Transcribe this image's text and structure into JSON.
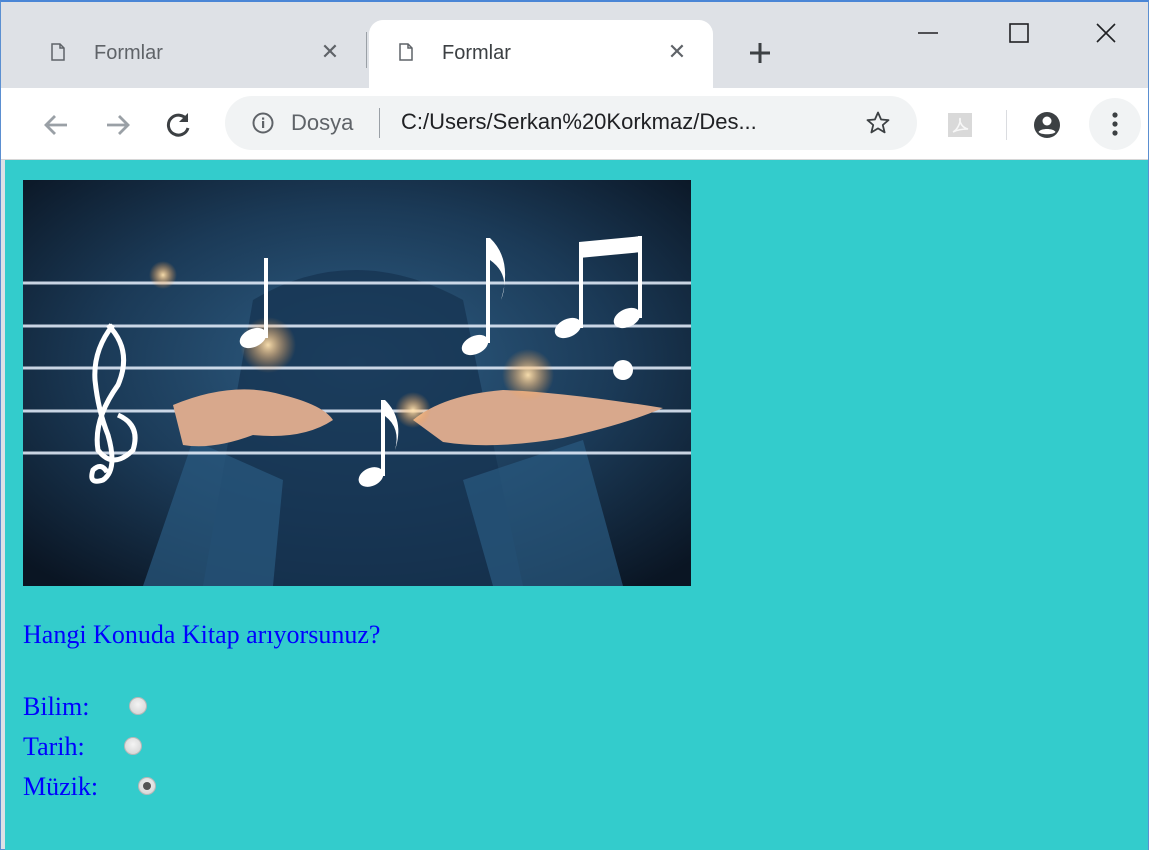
{
  "tabs": [
    {
      "title": "Formlar",
      "active": false
    },
    {
      "title": "Formlar",
      "active": true
    }
  ],
  "toolbar": {
    "scheme_label": "Dosya",
    "url": "C:/Users/Serkan%20Korkmaz/Des..."
  },
  "page": {
    "question": "Hangi Konuda Kitap arıyorsunuz?",
    "options": [
      {
        "label": "Bilim:",
        "checked": false
      },
      {
        "label": "Tarih:",
        "checked": false
      },
      {
        "label": "Müzik:",
        "checked": true
      }
    ],
    "background_color": "#33cccc",
    "text_color": "#0000ff"
  }
}
